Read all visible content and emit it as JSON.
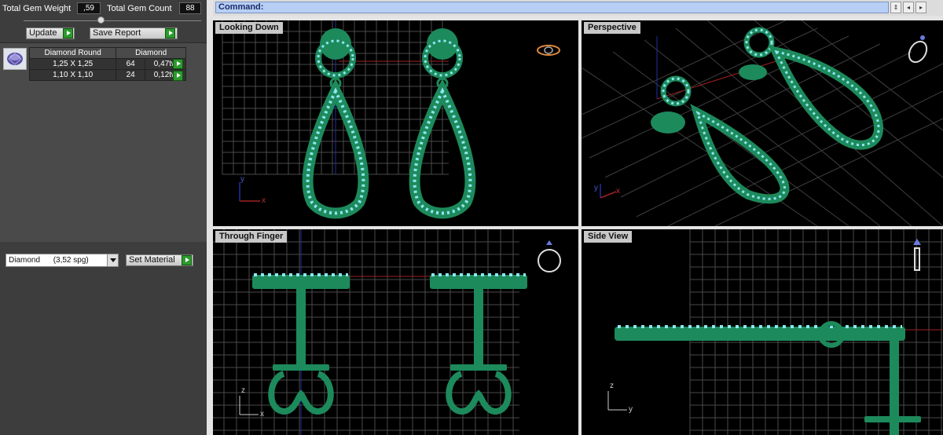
{
  "left_panel": {
    "total_gem_weight_label": "Total Gem Weight",
    "total_gem_weight_value": ",59",
    "total_gem_count_label": "Total Gem Count",
    "total_gem_count_value": "88",
    "update_label": "Update",
    "save_report_label": "Save Report",
    "gem_table": {
      "headers": [
        "Diamond Round",
        "Diamond"
      ],
      "rows": [
        {
          "size": "1,25 X 1,25",
          "count": "64",
          "weight": "0,47tw"
        },
        {
          "size": "1,10 X 1,10",
          "count": "24",
          "weight": "0,12tw"
        }
      ]
    },
    "material_value": "Diamond      (3,52 spg)",
    "set_material_label": "Set Material"
  },
  "command": {
    "label": "Command:"
  },
  "viewports": {
    "top": {
      "title": "Looking Down",
      "axis_v": "y",
      "axis_h": "x"
    },
    "perspective": {
      "title": "Perspective",
      "axis_v": "y",
      "axis_h": "x"
    },
    "front": {
      "title": "Through Finger",
      "axis_v": "z",
      "axis_h": "x"
    },
    "side": {
      "title": "Side View",
      "axis_v": "z",
      "axis_h": "y"
    }
  },
  "colors": {
    "metal": "#1d8a5c",
    "metal_light": "#2fbf86",
    "gem": "#8fe6f0",
    "grid": "#4a4a4a",
    "axis_red": "#a02020",
    "axis_blue": "#2030a0"
  }
}
